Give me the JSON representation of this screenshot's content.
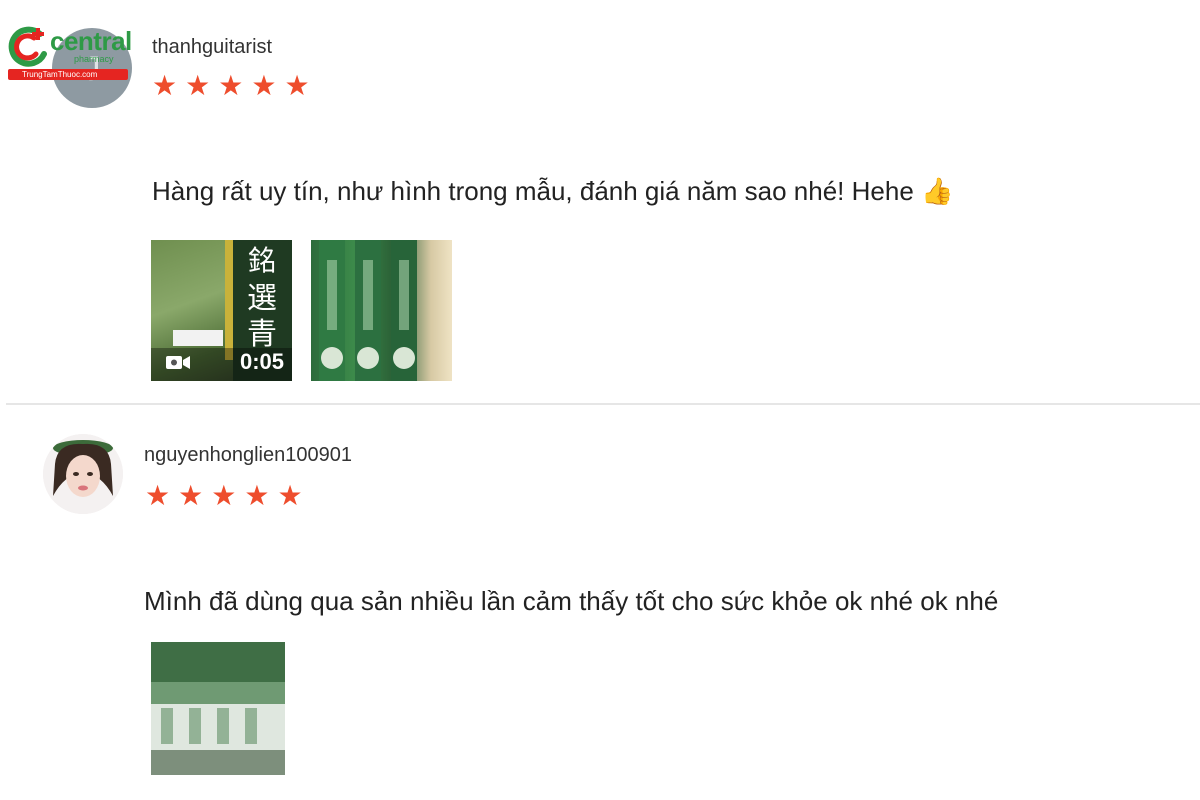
{
  "logo": {
    "name": "central",
    "sub": "pharmacy",
    "bar_text": "TrungTamThuoc.com"
  },
  "reviews": [
    {
      "username": "thanhguitarist",
      "rating": 5,
      "comment": "Hàng rất uy tín, như hình trong mẫu, đánh giá năm sao nhé! Hehe 👍",
      "video_duration": "0:05"
    },
    {
      "username": "nguyenhonglien100901",
      "rating": 5,
      "comment": "Mình đã dùng qua sản nhiều lần cảm thấy tốt cho sức khỏe ok nhé ok nhé"
    }
  ],
  "colors": {
    "star": "#ee4d2d",
    "logo_green": "#2e9a46",
    "logo_red": "#e52521"
  }
}
